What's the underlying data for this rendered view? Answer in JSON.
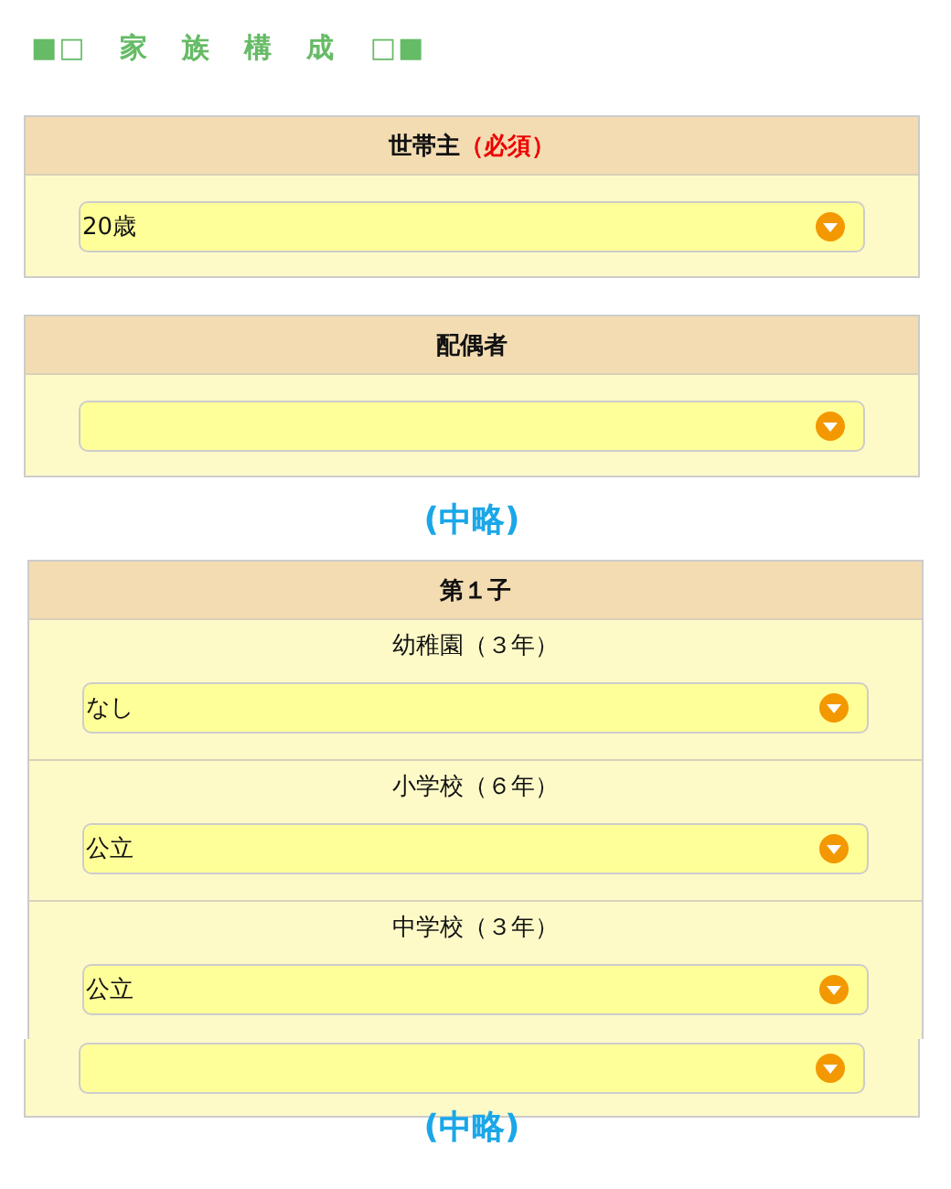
{
  "heading": {
    "left_mark": "■□",
    "title": "家　族　構　成",
    "right_mark": "□■"
  },
  "sections": [
    {
      "kind": "panel",
      "title": "世帯主",
      "required_note": "（必須）",
      "select": {
        "value": "20歳"
      }
    },
    {
      "kind": "panel",
      "title": "配偶者"
    },
    {
      "kind": "omitted",
      "text": "(中略)"
    },
    {
      "kind": "child",
      "title": "第１子",
      "rows": [
        {
          "label": "幼稚園（３年）",
          "select": {
            "value": "なし"
          }
        },
        {
          "label": "小学校（６年）",
          "select": {
            "value": "公立"
          }
        },
        {
          "label": "中学校（３年）",
          "select": {
            "value": "公立"
          }
        }
      ]
    },
    {
      "kind": "fragment"
    },
    {
      "kind": "omitted",
      "text": "(中略)"
    }
  ]
}
